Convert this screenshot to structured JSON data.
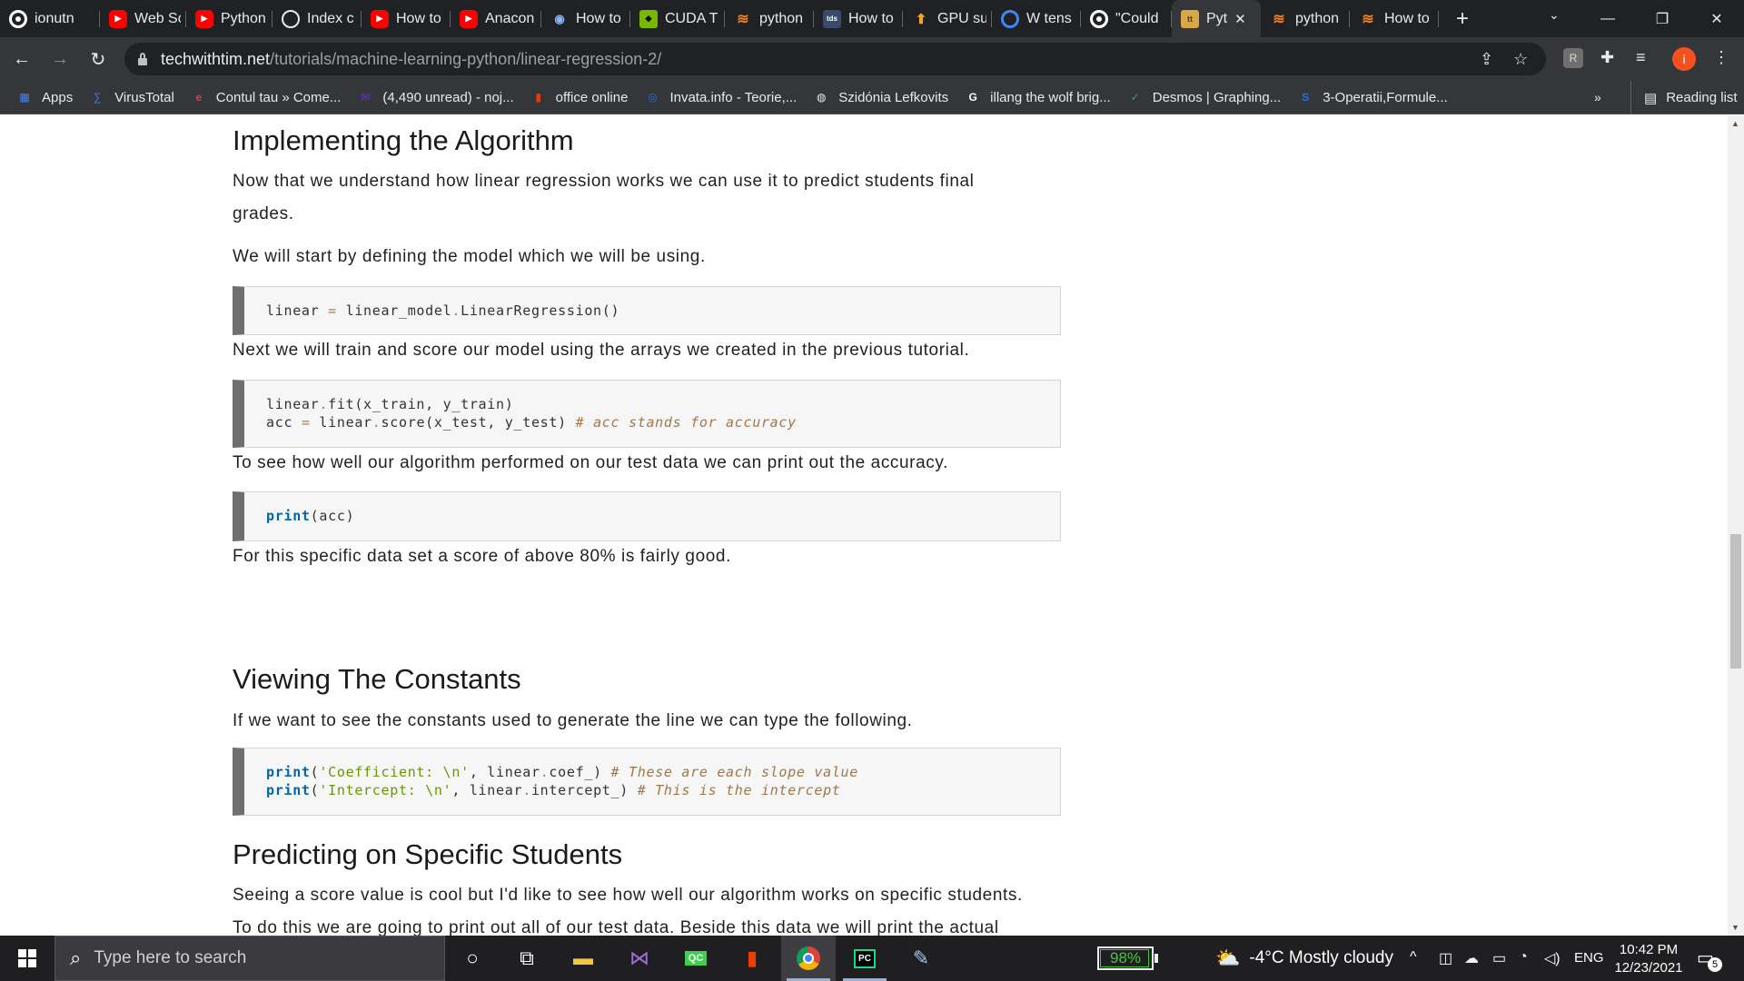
{
  "browser": {
    "tabs": [
      {
        "label": "ionutn",
        "icon": "github-icon"
      },
      {
        "label": "Web Sc",
        "icon": "youtube-icon"
      },
      {
        "label": "Python",
        "icon": "youtube-icon"
      },
      {
        "label": "Index c",
        "icon": "globe-icon"
      },
      {
        "label": "How to",
        "icon": "youtube-icon"
      },
      {
        "label": "Anacon",
        "icon": "youtube-icon"
      },
      {
        "label": "How to",
        "icon": "wifi-icon"
      },
      {
        "label": "CUDA T",
        "icon": "nvidia-icon"
      },
      {
        "label": "python",
        "icon": "stackoverflow-icon"
      },
      {
        "label": "How to",
        "icon": "tds-icon"
      },
      {
        "label": "GPU su",
        "icon": "tensorflow-icon"
      },
      {
        "label": "W tens",
        "icon": "circle-icon"
      },
      {
        "label": "\"Could",
        "icon": "github-icon"
      },
      {
        "label": "Pyt",
        "icon": "techwithtim-icon",
        "active": true
      },
      {
        "label": "python",
        "icon": "stackoverflow-icon"
      },
      {
        "label": "How to",
        "icon": "stackoverflow-icon"
      }
    ],
    "new_tab": "+",
    "url_host": "techwithtim.net",
    "url_path": "/tutorials/machine-learning-python/linear-regression-2/",
    "profile_initial": "i",
    "bookmarks": [
      {
        "label": "Apps",
        "icon": "apps-grid-icon"
      },
      {
        "label": "VirusTotal",
        "icon": "virustotal-icon"
      },
      {
        "label": "Contul tau » Come...",
        "icon": "emag-icon"
      },
      {
        "label": "(4,490 unread) - noj...",
        "icon": "yahoo-mail-icon"
      },
      {
        "label": "office online",
        "icon": "office-icon"
      },
      {
        "label": "Invata.info - Teorie,...",
        "icon": "invata-icon"
      },
      {
        "label": "Szidónia Lefkovits",
        "icon": "globe-icon"
      },
      {
        "label": "illang the wolf brig...",
        "icon": "google-icon"
      },
      {
        "label": "Desmos | Graphing...",
        "icon": "desmos-icon"
      },
      {
        "label": "3-Operatii,Formule...",
        "icon": "s-icon"
      }
    ],
    "bookmarks_more": "»",
    "reading_list": "Reading list"
  },
  "article": {
    "h_implementing": "Implementing the Algorithm",
    "p_intro_1": "Now that we understand how linear regression works we can use it to predict students final",
    "p_intro_2": "grades.",
    "p_define": "We will start by defining the model which we will be using.",
    "p_train": "Next we will train and score our model using the arrays we created in the previous tutorial.",
    "p_print_acc": "To see how well our algorithm performed on our test data we can print out the accuracy.",
    "p_score": "For this specific data set a score of above 80% is fairly good.",
    "h_constants": "Viewing The Constants",
    "p_constants": "If we want to see the constants used to generate the line we can type the following.",
    "h_predicting": "Predicting on Specific Students",
    "p_predict_1": "Seeing a score value is cool but I'd like to see how well our algorithm works on specific students.",
    "p_predict_2": "To do this we are going to print out all of our test data. Beside this data we will print the actual"
  },
  "code": {
    "c1_a": "linear ",
    "c1_op": "=",
    "c1_b": " linear_model",
    "c1_dot": ".",
    "c1_c": "LinearRegression()",
    "c2l1_a": "linear",
    "c2l1_dot": ".",
    "c2l1_b": "fit(x_train, y_train)",
    "c2l2_a": "acc ",
    "c2l2_op": "=",
    "c2l2_b": " linear",
    "c2l2_dot": ".",
    "c2l2_c": "score(x_test, y_test) ",
    "c2l2_cm": "# acc stands for accuracy",
    "c3_kw": "print",
    "c3_rest": "(acc)",
    "c4l1_kw": "print",
    "c4l1_p": "(",
    "c4l1_str": "'Coefficient: \\n'",
    "c4l1_b": ", linear",
    "c4l1_dot": ".",
    "c4l1_c": "coef_) ",
    "c4l1_cm": "# These are each slope value",
    "c4l2_kw": "print",
    "c4l2_p": "(",
    "c4l2_str": "'Intercept: \\n'",
    "c4l2_b": ", linear",
    "c4l2_dot": ".",
    "c4l2_c": "intercept_) ",
    "c4l2_cm": "# This is the intercept"
  },
  "taskbar": {
    "search_placeholder": "Type here to search",
    "battery": "98%",
    "weather": "-4°C  Mostly cloudy",
    "language": "ENG",
    "time": "10:42 PM",
    "date": "12/23/2021",
    "notifications": "5"
  }
}
